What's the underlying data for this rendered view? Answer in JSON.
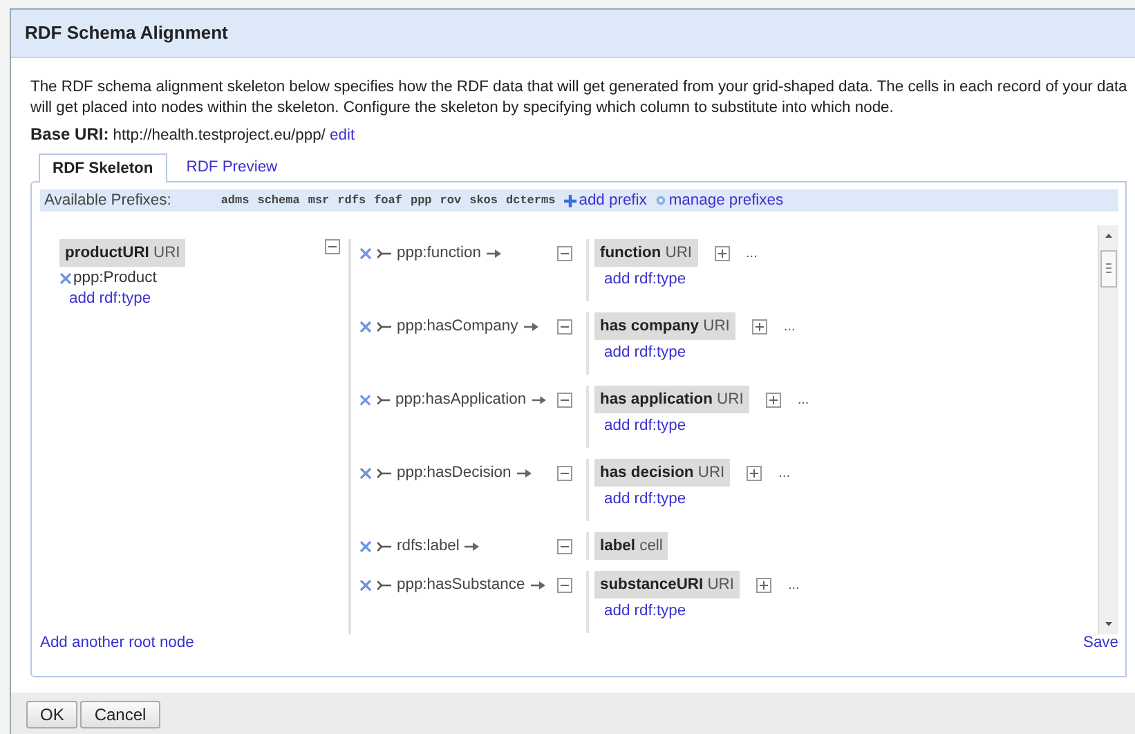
{
  "window": {
    "title": "RDF Schema Alignment"
  },
  "description": "The RDF schema alignment skeleton below specifies how the RDF data that will get generated from your grid-shaped data. The cells in each record of your data will get placed into nodes within the skeleton. Configure the skeleton by specifying which column to substitute into which node.",
  "base_uri": {
    "label": "Base URI:",
    "value": "http://health.testproject.eu/ppp/",
    "edit": "edit"
  },
  "tabs": [
    {
      "label": "RDF Skeleton",
      "selected": true
    },
    {
      "label": "RDF Preview",
      "selected": false
    }
  ],
  "prefixes": {
    "label": "Available Prefixes:",
    "items": [
      "adms",
      "schema",
      "msr",
      "rdfs",
      "foaf",
      "ppp",
      "rov",
      "skos",
      "dcterms"
    ],
    "add": "add prefix",
    "manage": "manage prefixes"
  },
  "root": {
    "name": "productURI",
    "type": "URI",
    "types": [
      "ppp:Product"
    ],
    "add_type": "add rdf:type"
  },
  "properties": [
    {
      "name": "ppp:function",
      "target": {
        "name": "function",
        "type": "URI",
        "expandable": true,
        "more": "...",
        "add_type": "add rdf:type"
      }
    },
    {
      "name": "ppp:hasCompany",
      "target": {
        "name": "has company",
        "type": "URI",
        "expandable": true,
        "more": "...",
        "add_type": "add rdf:type"
      }
    },
    {
      "name": "ppp:hasApplication",
      "target": {
        "name": "has application",
        "type": "URI",
        "expandable": true,
        "more": "...",
        "add_type": "add rdf:type"
      }
    },
    {
      "name": "ppp:hasDecision",
      "target": {
        "name": "has decision",
        "type": "URI",
        "expandable": true,
        "more": "...",
        "add_type": "add rdf:type"
      }
    },
    {
      "name": "rdfs:label",
      "target": {
        "name": "label",
        "type": "cell",
        "expandable": false
      }
    },
    {
      "name": "ppp:hasSubstance",
      "target": {
        "name": "substanceURI",
        "type": "URI",
        "expandable": true,
        "more": "...",
        "add_type": "add rdf:type"
      }
    }
  ],
  "add_root": "Add another root node",
  "save": "Save",
  "buttons": [
    "OK",
    "Cancel"
  ]
}
